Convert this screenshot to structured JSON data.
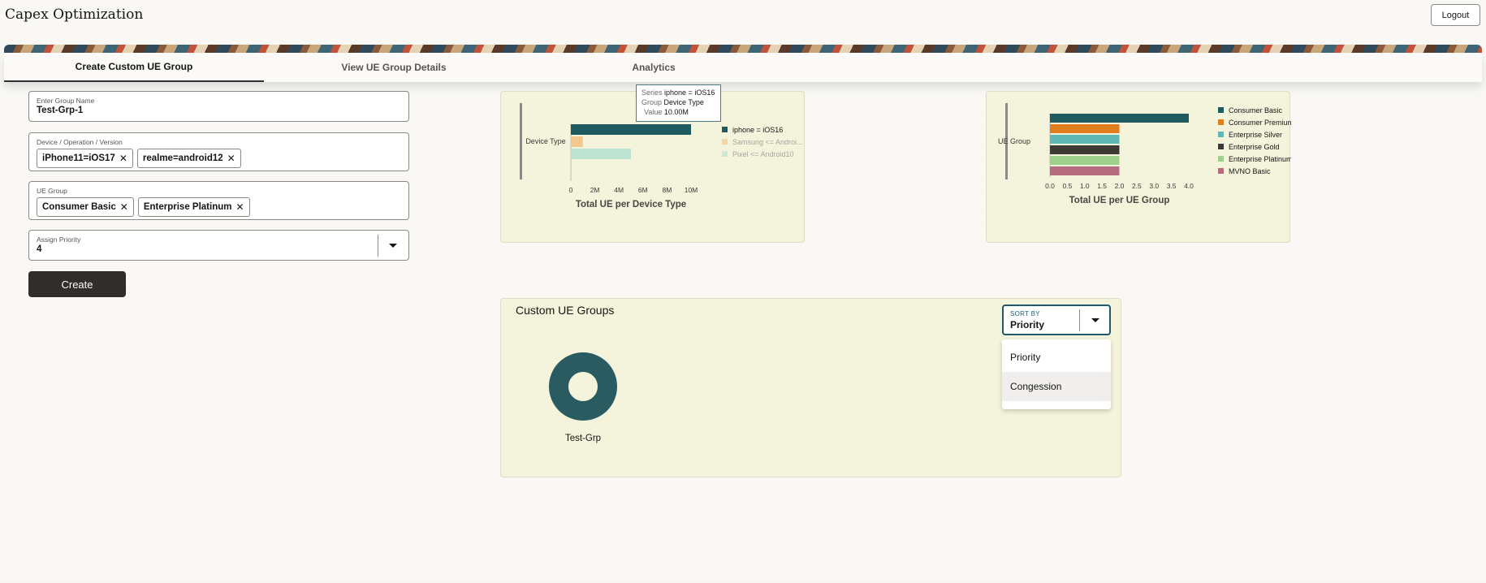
{
  "app": {
    "title": "Capex Optimization",
    "logout_label": "Logout"
  },
  "tabs": [
    {
      "label": "Create Custom UE Group",
      "active": true
    },
    {
      "label": "View UE Group Details",
      "active": false
    },
    {
      "label": "Analytics",
      "active": false
    }
  ],
  "form": {
    "group_name": {
      "label": "Enter Group Name",
      "value": "Test-Grp-1"
    },
    "device": {
      "label": "Device / Operation / Version",
      "chips": [
        "iPhone11=iOS17",
        "realme=android12"
      ]
    },
    "ue_group": {
      "label": "UE Group",
      "chips": [
        "Consumer Basic",
        "Enterprise Platinum"
      ]
    },
    "priority": {
      "label": "Assign Priority",
      "value": "4"
    },
    "create_label": "Create"
  },
  "tooltip": {
    "series_key": "Series",
    "series_val": "iphone = iOS16",
    "group_key": "Group",
    "group_val": "Device Type",
    "value_key": "Value",
    "value_val": "10.00M"
  },
  "chart_data": [
    {
      "type": "bar",
      "orientation": "horizontal",
      "title": "Total UE per Device Type",
      "categories": [
        "Device Type"
      ],
      "series": [
        {
          "name": "iphone = iOS16",
          "values": [
            10000000
          ],
          "color": "#1f5a5e"
        },
        {
          "name": "Samsung <= Androi...",
          "values": [
            1000000
          ],
          "color": "#f3c88e"
        },
        {
          "name": "Pixel <= Android10",
          "values": [
            5000000
          ],
          "color": "#bde3d2"
        }
      ],
      "x_ticks": [
        "0",
        "2M",
        "4M",
        "6M",
        "8M",
        "10M"
      ],
      "xlim": [
        0,
        10000000
      ]
    },
    {
      "type": "bar",
      "orientation": "horizontal",
      "title": "Total UE per UE Group",
      "categories": [
        "UE Group"
      ],
      "series": [
        {
          "name": "Consumer Basic",
          "values": [
            4.0
          ],
          "color": "#1f5a5e"
        },
        {
          "name": "Consumer Premium",
          "values": [
            2.0
          ],
          "color": "#e07d1f"
        },
        {
          "name": "Enterprise Silver",
          "values": [
            2.0
          ],
          "color": "#5fb8b4"
        },
        {
          "name": "Enterprise Gold",
          "values": [
            2.0
          ],
          "color": "#3d3a36"
        },
        {
          "name": "Enterprise Platinum",
          "values": [
            2.0
          ],
          "color": "#9fd08c"
        },
        {
          "name": "MVNO Basic",
          "values": [
            2.0
          ],
          "color": "#b76b7f"
        }
      ],
      "x_ticks": [
        "0.0",
        "0.5",
        "1.0",
        "1.5",
        "2.0",
        "2.5",
        "3.0",
        "3.5",
        "4.0"
      ],
      "xlim": [
        0,
        4.0
      ]
    }
  ],
  "groups_panel": {
    "title": "Custom UE Groups",
    "sort_label": "SORT BY",
    "sort_value": "Priority",
    "sort_options": [
      "Priority",
      "Congession"
    ],
    "groups": [
      {
        "name": "Test-Grp",
        "color": "#2a5b60"
      }
    ]
  }
}
